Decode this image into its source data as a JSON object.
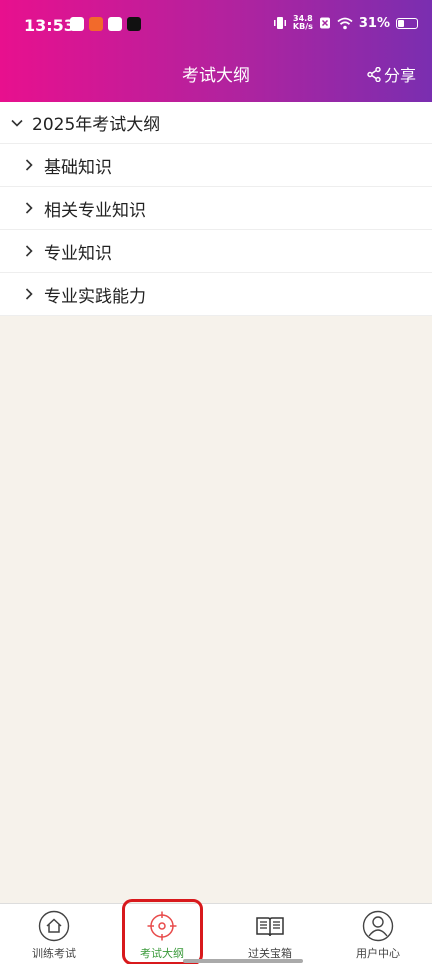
{
  "status_bar": {
    "time": "13:53",
    "net_speed_top": "34.8",
    "net_speed_bottom": "KB/s",
    "battery": "31%"
  },
  "header": {
    "title": "考试大纲",
    "share_label": "分享"
  },
  "tree": {
    "root_label": "2025年考试大纲",
    "items": [
      {
        "label": "基础知识"
      },
      {
        "label": "相关专业知识"
      },
      {
        "label": "专业知识"
      },
      {
        "label": "专业实践能力"
      }
    ]
  },
  "bottom_nav": {
    "items": [
      {
        "label": "训练考试"
      },
      {
        "label": "考试大纲"
      },
      {
        "label": "过关宝箱"
      },
      {
        "label": "用户中心"
      }
    ],
    "active_index": 1
  },
  "colors": {
    "header_gradient_start": "#e8108e",
    "header_gradient_end": "#7a2eb0",
    "active_tab": "#3a9a3a",
    "highlight": "#d8191c",
    "background": "#f6f2eb"
  }
}
